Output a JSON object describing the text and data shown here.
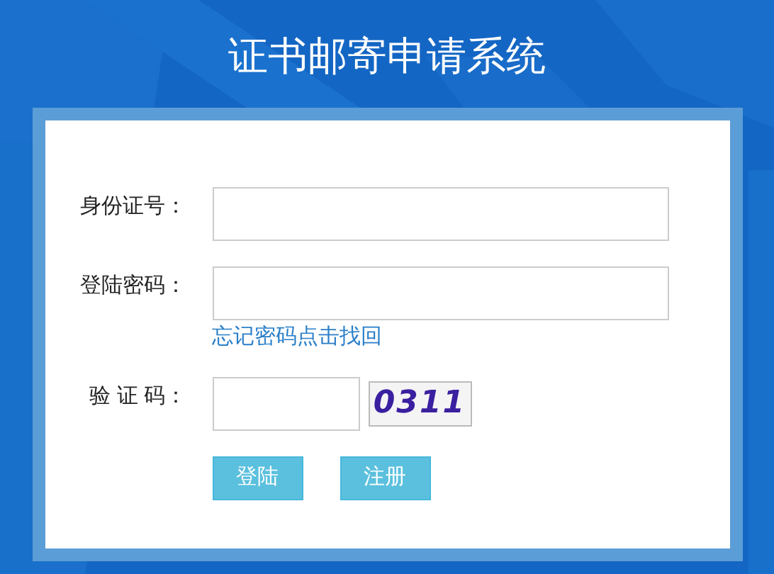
{
  "title": "证书邮寄申请系统",
  "fields": [
    {
      "label": "身份证号：",
      "kind": "text"
    },
    {
      "label": "登陆密码：",
      "kind": "password",
      "link": "忘记密码点击找回"
    },
    {
      "label": "验 证 码：",
      "kind": "captcha",
      "captcha": "0311"
    }
  ],
  "buttons": [
    "登陆",
    "注册"
  ]
}
